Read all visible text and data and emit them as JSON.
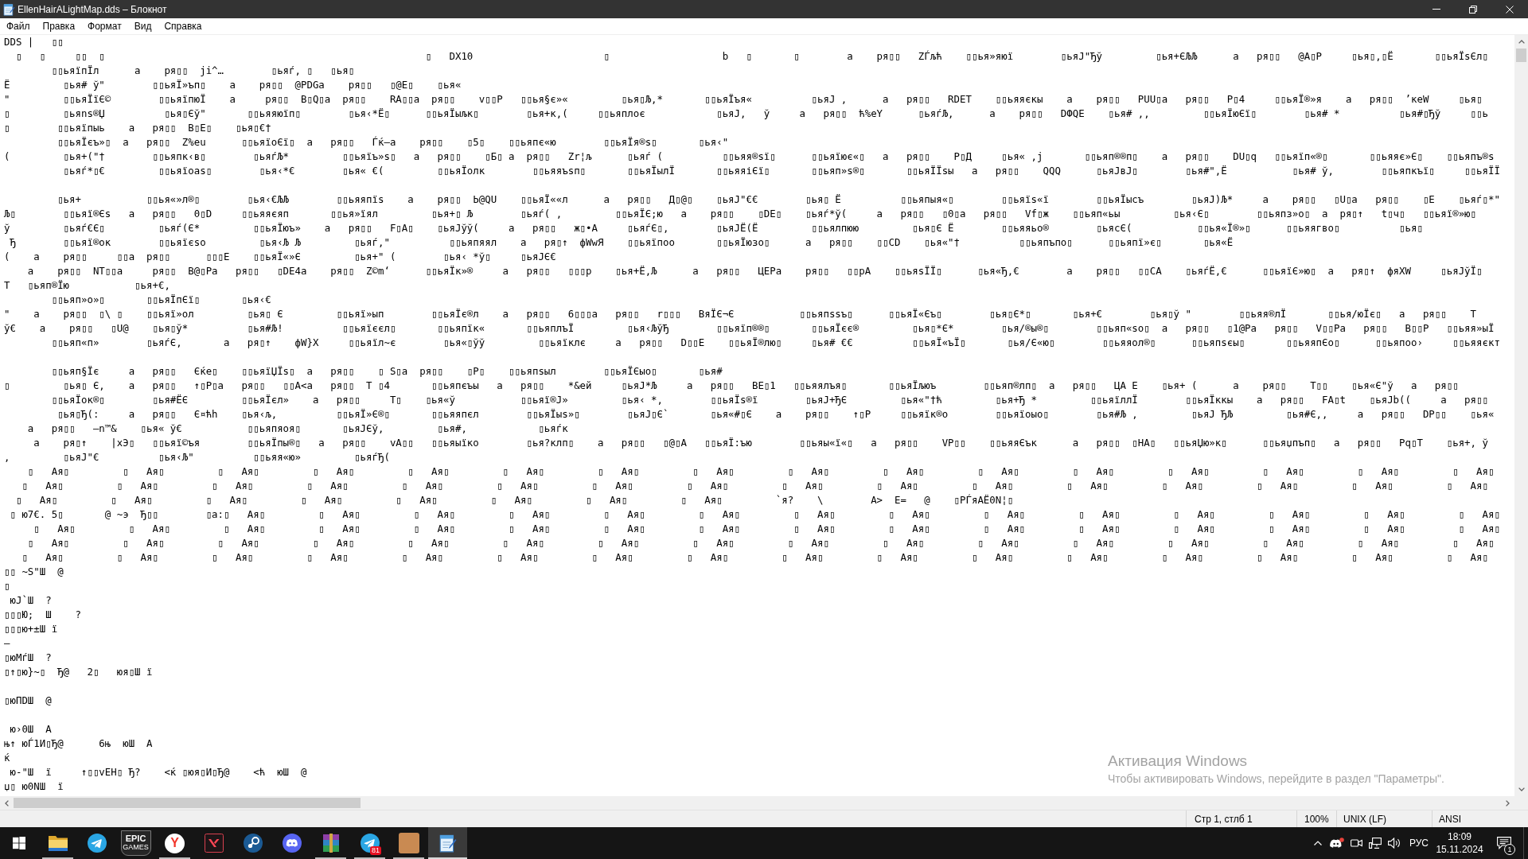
{
  "window": {
    "title": "EllenHairALightMap.dds – Блокнот"
  },
  "menu": [
    "Файл",
    "Правка",
    "Формат",
    "Вид",
    "Справка"
  ],
  "editor": {
    "blocks": [
      [
        "DDS |   ▯▯",
        "  ▯   ▯     ▯▯  ▯                                                      ▯   DX10                      ▯                   b   ▯       ▯        a    ря▯▯   ZЃљћ    ▯▯ья»яюї        ▯ьяЈ\"Ђў         ▯ья+ЄЉЉ      a   ря▯▯   @A▯P     ▯ья▯,▯Ё       ▯▯ьяЇsЄл▯",
        "        ▯▯ьяїпЇл      a    ря▯▯  ji^…        ▯ьяѓ, ▯   ▯ья▯",
        "Ë         ▯ья# ў\"        ▯▯ьяЇ»ъп▯    a    ря▯▯  @PDGa    ря▯▯   ▯@E▯    ▯ья«",
        "\"         ▯▯ьяЇїЄ©        ▯▯ьяїпюЇ    a     ря▯▯  B▯Q▯a  ря▯▯    RA▯▯a  ря▯▯    v▯▯P   ▯▯ья§є»«         ▯ья▯Љ,*       ▯▯ьяЇъя«          ▯ьяЈ ,      a   ря▯▯   RDET    ▯▯ьяяєкы    a    ря▯▯   PUU▯a   ря▯▯   P▯4     ▯▯ьяЇ®»я    a   ря▯▯  ’кеW     ▯ья▯",
        "▯         ▯ьяns®Џ          ▯ья▯Єў\"       ▯▯ьяяюїп▯        ▯ья‹*Ё▯      ▯▯ьяЇыљк▯        ▯ья+к,(     ▯▯ьяплоє            ▯ьяЈ,   ў     a   ря▯▯  ћ%eY      ▯ьяѓЉ,      a    ря▯▯   DФQE    ▯ья# ,,         ▯▯ьяЇюЄї▯        ▯ья# *          ▯ья#▯Ђў     ▯▯ь",
        "▯        ▯▯ьяїпыь    a   ря▯▯  B▯E▯    ▯ья▯€†",
        "         ▯▯ьяЇєъ»▯  a   ря▯▯  Z%eu      ▯▯ьяїоЄї▯  a   ря▯▯   Ѓќ–a    ря▯▯    ▯5▯    ▯▯ьяпє«ю        ▯▯ьяЇя®s▯       ▯ья‹\"",
        "(         ▯ья+(\"†        ▯▯ьяпк‹в▯        ▯ьяѓЉ*         ▯▯ьяїъ»s▯   a   ря▯▯    ▯Б▯ a  ря▯▯   Zr¦љ      ▯ьяѓ (          ▯▯ьяя®sї▯      ▯▯ьяїює«▯   a   ря▯▯    P▯Д     ▯ья« ,j       ▯▯ьяп®®п▯    a   ря▯▯    DU▯q   ▯▯ьяїп«®▯       ▯▯ьяяє»Є▯    ▯▯ьяпъ®s",
        "          ▯ьяѓ*▯€         ▯▯ьяїоаs▯        ▯ья‹*€        ▯ья« €(         ▯▯ьяЇолк        ▯▯ьяяъsп▯       ▯▯ьяЇылЇ       ▯▯ьяяіЄї▯       ▯▯ьяп»s®▯       ▯▯ьяЇЇsы   a   ря▯▯    QQQ      ▯ьяЈвЈ▯        ▯ья#\",Ё           ▯ья# ў,        ▯▯ьяпкъї▯     ▯▯ьяЇЇ"
      ],
      [
        "         ▯ья+           ▯▯ья«»л®▯        ▯ья‹€ЉЉ        ▯▯ьяяпїs    a    ря▯▯  Ь@QU    ▯▯ьяЇ««л      a   ря▯▯   Д▯@▯    ▯ьяЈ\"€€        ▯ья▯ Ё          ▯▯ьяпыя«▯        ▯▯ьяїs«ї        ▯▯ьяЇысъ        ▯ьяЈ)Љ*     a    ря▯▯   ▯U▯a   ря▯▯    ▯Е    ▯ьяѓ▯*\"",
        "Љ▯        ▯▯ьяї®Єs   a   ря▯▯   0▯D     ▯▯ьяяєяп       ▯▯ья»їял         ▯ья+▯ Љ        ▯ьяѓ( ,         ▯▯ьяЇЄ;ю   a    ря▯▯    ▯DE▯    ▯ьяѓ*ў(     a   ря▯▯   ▯0▯a   ря▯▯   Vf▯ж    ▯▯ьяп«ьы         ▯ья‹Є▯        ▯▯ьяпз»о▯  a  ря▯↑   t▯ч▯   ▯▯ьяї®»ю▯",
        "ў         ▯ьяѓ€Є▯         ▯ьяѓ(Є*         ▯▯ьяЇюъ»    a   ря▯▯   F▯A▯    ▯ьяЈўў(     a   ря▯▯   ж▯•A     ▯ьяѓЄ▯,        ▯ьяЈЁ(Ё         ▯▯ьялпюю         ▯ья▯Є Ё        ▯▯ьяяьо®        ▯ьясЄ(           ▯▯ья«Ї®»▯      ▯▯ьяягво▯          ▯ья▯",
        " Ђ        ▯▯ьяї®ок        ▯▯ьяїєso         ▯ья‹Љ Љ         ▯ьяѓ,\"          ▯▯ьяпяял    a   ря▯↑  фWwЯ    ▯▯ьяїпоо       ▯▯ьяЇюзо▯      a   ря▯▯    ▯▯CD    ▯ья«\"†          ▯▯ьяпъпо▯      ▯▯ьяпї»є▯       ▯ья«Ё",
        "(    a    ря▯▯     ▯▯a  ря▯▯      ▯▯▯E    ▯▯ьяЇ«»Є         ▯ья+\" (        ▯ья‹ *ў▯     ▯ьяЈЄ€",
        "    a    ря▯▯  NT▯▯a     ря▯▯  B@▯Pa   ря▯▯   ▯DE4a    ря▯▯  Z©m‘      ▯▯ьяЇк»®     a   ря▯▯   ▯▯▯p    ▯ья+Ё,Љ      a   ря▯▯   ЦЕPa    ря▯▯   ▯▯pA    ▯▯ьяsЇЇ▯      ▯ья«Ђ,€        a    ря▯▯   ▯▯CA    ▯ьяѓЁ,€      ▯▯ьяїЄ»ю▯  a   ря▯↑  фяXW     ▯ьяЈўЇ▯",
        "T   ▯ьяп®Їю           ▯ья+€,",
        "        ▯▯ьяп»о»▯       ▯▯ьяЇпЄї▯       ▯ья‹€",
        "\"    a    ря▯▯  ▯\\ ▯    ▯▯ьяї»ол         ▯ья▯ Є         ▯▯ьяї»ып        ▯▯ьяЇє®л    a   ря▯▯   6▯▯▯a   ря▯▯   r▯▯▯   BяЇЄ¬Є           ▯▯ьяпssъ▯      ▯▯ьяЇ«Єъ▯        ▯ья▯Є*▯       ▯ья+€        ▯ья▯ў \"        ▯▯ьяя®лЇ       ▯▯ья/юЇє▯   a   ря▯▯    T",
        "ў€    a    ря▯▯   ▯U@    ▯ья▯ў*          ▯ья#Љ!          ▯▯ьяїєєл▯       ▯▯ьяпїк«       ▯▯ьяплъЇ         ▯ья‹ЉўЂ        ▯▯ьяїп®®▯       ▯▯ьяЇєє®         ▯ья▯*Є*        ▯ья/®ы®▯        ▯▯ьяп«so▯  a   ря▯▯   ▯1@Pa   ря▯▯   V▯▯Pa   ря▯▯   B▯▯P   ▯▯ьяя»ыЇ",
        "        ▯▯ьяп«п»        ▯ьяѓЄ,       a   ря▯↑    фW}X     ▯▯ьяїл~є        ▯ья«▯ўў         ▯▯ьяїклє     a   ря▯▯   D▯▯E    ▯▯ьяЇ®лю▯     ▯ья# €€          ▯▯ьяЇ«ъЇ▯       ▯ья/Є«ю▯        ▯▯ьяяол®▯      ▯▯ьяпsєы▯       ▯▯ьяяпЄо▯      ▯▯ьяпоо›     ▯▯ьяяєкт"
      ],
      [
        "        ▯▯ьяп§Їє     a   ря▯▯   Єќе▯    ▯▯ьяїЏЇs▯  a   ря▯▯    ▯ S▯a  ря▯▯    ▯P▯    ▯▯ьяпsыл        ▯▯ьяЇЄыо▯       ▯ья#",
        "▯         ▯ья▯ Є,    a   ря▯▯   ↑▯P▯a   ря▯▯   ▯▯A<a   ря▯▯  T ▯4       ▯▯ьяпєъы   a   ря▯▯    *&ей     ▯ьяЈ*Љ     a   ря▯▯   BE▯1   ▯▯ьяялъя▯       ▯▯ьяЇљюъ        ▯▯ьяп®лп▯  a   ря▯▯   ЦА Е    ▯ья+ (      a    ря▯▯    T▯▯    ▯ья«Є\"ў   a   ря▯▯",
        "        ▯▯ьяЇок®▯        ▯ья#ЁЄ         ▯▯ьяЇєл»    a   ря▯▯     T▯    ▯ья«ў           ▯▯ьяї®Ј»         ▯ья‹ *,        ▯▯ьяЇs®ї        ▯ьяЈ+ЂЄ         ▯ья«\"†ћ         ▯ья+Ђ *         ▯▯ьяїллЇ        ▯▯ьяЇккы    a   ря▯▯   FA▯t    ▯ьяЈb((     a   ря▯▯",
        "         ▯ья▯Ђ(:     a   ря▯▯   Є¤ћh    ▯ья‹љ,          ▯▯ьяЇ»Є®▯       ▯▯ьяяпєл        ▯▯ьяЇыs»▯        ▯ьяЈ▯Є`       ▯ья«#▯Є    a    ря▯▯    ↑▯P     ▯▯ьяїк®о        ▯▯ьяїоыо▯        ▯ья#Љ ,         ▯ьяЈ ЂЉ         ▯ья#Є,,     a   ря▯▯   DP▯▯    ▯ья«",
        "    a   ря▯▯   –n™&    ▯ья« ў€           ▯▯ьяпяоя▯       ▯ьяЈЄў,         ▯ья#,            ▯ьяѓк",
        "     a    ря▯↑    |xЭ▯   ▯▯ьяї©ъя        ▯▯ьяЇпы®▯   a   ря▯▯    vA▯▯   ▯▯ьяыїко        ▯ья?клп▯    a   ря▯▯   ▯@▯A   ▯▯ьяЇ:ъю        ▯▯ьяы«ї«▯   a   ря▯▯    VP▯▯    ▯▯ьяяЄък      a   ря▯▯  ▯HA▯   ▯▯ьяЏю»к▯      ▯▯ьяџпъп▯   a   ря▯▯   Pq▯T    ▯ья+, ў",
        ",         ▯ьяЈ\"€          ▯ья‹Љ\"          ▯▯ьяя«ю»         ▯ьяѓЂ(",
        "    ▯   Ая▯         ▯   Ая▯         ▯   Ая▯         ▯   Ая▯         ▯   Ая▯         ▯   Ая▯         ▯   Ая▯         ▯   Ая▯         ▯   Ая▯         ▯   Ая▯         ▯   Ая▯         ▯   Ая▯         ▯   Ая▯         ▯   Ая▯         ▯   Ая▯         ▯   Ая▯",
        "   ▯   Ая▯         ▯   Ая▯         ▯   Ая▯         ▯   Ая▯         ▯   Ая▯         ▯   Ая▯         ▯   Ая▯         ▯   Ая▯         ▯   Ая▯         ▯   Ая▯         ▯   Ая▯         ▯   Ая▯         ▯   Ая▯         ▯   Ая▯         ▯   Ая▯         ▯   Ая▯",
        "  ▯   Ая▯         ▯   Ая▯         ▯   Ая▯         ▯   Ая▯         ▯   Ая▯         ▯   Ая▯         ▯   Ая▯         ▯   Ая▯         `я?    \\        A>  E=   @    ▯PЃяAЁ0N¦▯",
        " ▯ ю7€. 5▯       @ ~э  Ђ▯▯        ▯a:▯   Ая▯         ▯   Ая▯         ▯   Ая▯         ▯   Ая▯         ▯   Ая▯         ▯   Ая▯         ▯   Ая▯         ▯   Ая▯         ▯   Ая▯         ▯   Ая▯         ▯   Ая▯         ▯   Ая▯         ▯   Ая▯         ▯   Ая▯",
        "     ▯   Ая▯         ▯   Ая▯         ▯   Ая▯         ▯   Ая▯         ▯   Ая▯         ▯   Ая▯         ▯   Ая▯         ▯   Ая▯         ▯   Ая▯         ▯   Ая▯         ▯   Ая▯         ▯   Ая▯         ▯   Ая▯         ▯   Ая▯         ▯   Ая▯         ▯   Ая▯",
        "    ▯   Ая▯         ▯   Ая▯         ▯   Ая▯         ▯   Ая▯         ▯   Ая▯         ▯   Ая▯         ▯   Ая▯         ▯   Ая▯         ▯   Ая▯         ▯   Ая▯         ▯   Ая▯         ▯   Ая▯         ▯   Ая▯         ▯   Ая▯         ▯   Ая▯         ▯   Ая▯",
        "   ▯   Ая▯         ▯   Ая▯         ▯   Ая▯         ▯   Ая▯         ▯   Ая▯         ▯   Ая▯         ▯   Ая▯         ▯   Ая▯         ▯   Ая▯         ▯   Ая▯         ▯   Ая▯         ▯   Ая▯         ▯   Ая▯         ▯   Ая▯         ▯   Ая▯         ▯   Ая▯",
        "▯▯ ~S\"Ш  @",
        "▯",
        " юЈ`Ш  ?",
        "▯▯▯Ю;  Ш    ?",
        "▯▯▯ю+±Ш ї",
        "–",
        "▯юМѓШ  ?",
        "▯↑▯ю}~▯  Ђ@   2▯   юя▯Ш ї"
      ],
      [
        "▯юПDШ  @"
      ],
      [
        " ю›0Ш  A",
        "њ↑ юЃ1И▯Ђ@      6њ  юШ  A",
        "ќ",
        " ю-\"Ш  ї     ↑▯▯vEH▯ Ђ?    <ќ ▯юя▯И▯Ђ@    <ћ  юШ  @",
        "џ▯ ю0NШ  ї"
      ]
    ]
  },
  "status_bar": {
    "position": "Стр 1, стлб 1",
    "zoom": "100%",
    "line_ending": "UNIX (LF)",
    "encoding": "ANSI"
  },
  "activation_notice": {
    "title": "Активация Windows",
    "text": "Чтобы активировать Windows, перейдите в раздел \"Параметры\"."
  },
  "taskbar": {
    "apps": [
      {
        "kind": "folder",
        "running": true,
        "active": false
      },
      {
        "kind": "paper-plane",
        "running": false,
        "active": false
      },
      {
        "kind": "shield-logo",
        "logo_text": "EPIC",
        "logo_subtext": "GAMES",
        "running": false,
        "active": false
      },
      {
        "kind": "letter-logo",
        "logo_text": "Y",
        "running": true,
        "active": false
      },
      {
        "kind": "v-mark",
        "running": false,
        "active": false
      },
      {
        "kind": "linked-circles",
        "running": false,
        "active": false
      },
      {
        "kind": "controller",
        "running": false,
        "active": false
      },
      {
        "kind": "books",
        "running": true,
        "active": false
      },
      {
        "kind": "paper-plane",
        "badge": "81",
        "running": true,
        "active": false
      },
      {
        "kind": "picture",
        "running": true,
        "active": false
      },
      {
        "kind": "notepad",
        "running": true,
        "active": true
      }
    ],
    "tray": {
      "language": "РУС",
      "time": "18:09",
      "date": "15.11.2024",
      "notification_count": "1"
    }
  }
}
